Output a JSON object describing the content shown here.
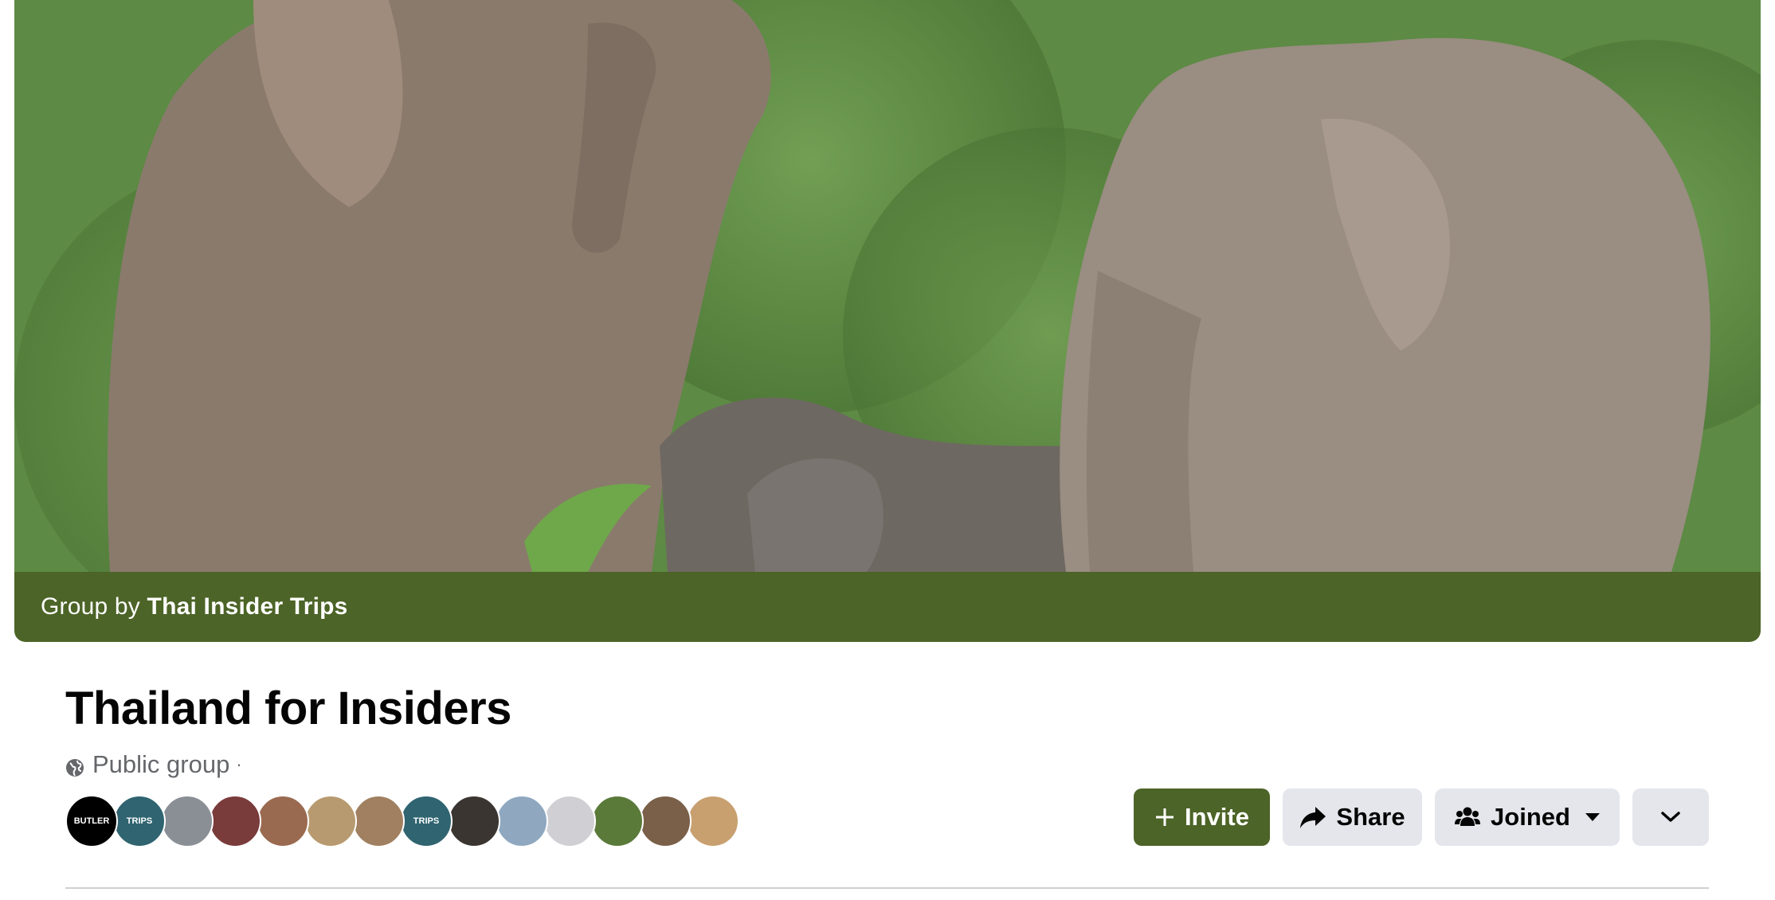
{
  "cover": {
    "group_by_prefix": "Group by",
    "owner_name": "Thai Insider Trips",
    "background_color": "#4c6427"
  },
  "group": {
    "name": "Thailand for Insiders",
    "privacy": "Public group",
    "separator": "·"
  },
  "members": [
    {
      "label": "BUTLER",
      "color": "#000000"
    },
    {
      "label": "TRIPS",
      "color": "#2f6470"
    },
    {
      "label": "",
      "color": "#8a8f96"
    },
    {
      "label": "",
      "color": "#7a3b3b"
    },
    {
      "label": "",
      "color": "#9a6a50"
    },
    {
      "label": "",
      "color": "#b89a70"
    },
    {
      "label": "",
      "color": "#a08060"
    },
    {
      "label": "TRIPS",
      "color": "#2f6470"
    },
    {
      "label": "",
      "color": "#3a3530"
    },
    {
      "label": "",
      "color": "#8fa8c0"
    },
    {
      "label": "",
      "color": "#d0d0d4"
    },
    {
      "label": "",
      "color": "#5a7a3a"
    },
    {
      "label": "",
      "color": "#7a6048"
    },
    {
      "label": "",
      "color": "#c8a070"
    }
  ],
  "actions": {
    "invite_label": "Invite",
    "share_label": "Share",
    "joined_label": "Joined"
  },
  "colors": {
    "brand": "#4c6427",
    "secondary_button": "#e4e6eb",
    "text_primary": "#050505",
    "text_secondary": "#65676b"
  }
}
